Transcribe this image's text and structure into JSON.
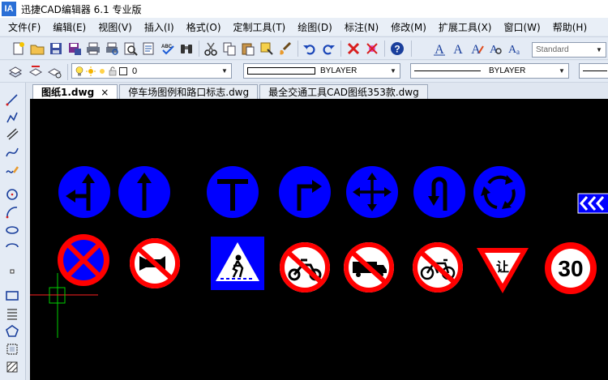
{
  "window": {
    "logo_text": "IA",
    "title": "迅捷CAD编辑器 6.1 专业版"
  },
  "menu": [
    "文件(F)",
    "编辑(E)",
    "视图(V)",
    "插入(I)",
    "格式(O)",
    "定制工具(T)",
    "绘图(D)",
    "标注(N)",
    "修改(M)",
    "扩展工具(X)",
    "窗口(W)",
    "帮助(H)"
  ],
  "toolbar": {
    "text_style": "Standard",
    "layer": "0",
    "color": "BYLAYER",
    "linetype": "BYLAYER"
  },
  "tabs": [
    {
      "label": "图纸1.dwg",
      "active": true,
      "close": "×"
    },
    {
      "label": "停车场图例和路口标志.dwg",
      "active": false
    },
    {
      "label": "最全交通工具CAD图纸353款.dwg",
      "active": false
    }
  ],
  "signs": {
    "speed_limit": "30",
    "yield_text": "让"
  },
  "colors": {
    "sign_blue": "#0000ff",
    "sign_red": "#ff0000",
    "canvas": "#000000"
  },
  "icons": [
    "new-icon",
    "open-icon",
    "save-icon",
    "saveas-icon",
    "print-icon",
    "print-preview-icon",
    "plot-icon",
    "find-icon",
    "zoom-icon",
    "spellcheck-icon",
    "binoculars-icon",
    "cut-icon",
    "copy-icon",
    "paste-icon",
    "match-properties-icon",
    "undo-icon",
    "redo-icon",
    "delete-icon",
    "purge-icon",
    "help-icon",
    "text-style-icon"
  ]
}
